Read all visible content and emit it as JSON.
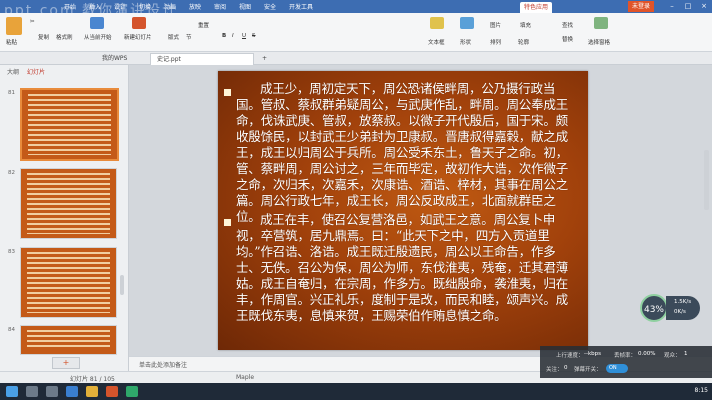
{
  "titlebar": {
    "tabs": [
      "开始",
      "插入",
      "设计",
      "切换",
      "动画",
      "放映",
      "审阅",
      "视图",
      "安全",
      "开发工具",
      "特色应用"
    ],
    "user_label": "未登录",
    "watermark": "ppt.com 教你演讲设计"
  },
  "ribbon": {
    "paste": "粘贴",
    "copy": "复制",
    "format_painter": "格式刷",
    "from_current": "从当前开始",
    "new_slide": "新建幻灯片",
    "layout": "版式",
    "section": "节",
    "reset": "重置",
    "font_buttons": [
      "B",
      "I",
      "U",
      "S"
    ],
    "textbox": "文本框",
    "shapes": "形状",
    "arrange": "排列",
    "outline": "轮廓",
    "picture": "图片",
    "fill": "填充",
    "find": "查找",
    "replace": "替换",
    "select_pane": "选择窗格"
  },
  "doc_tabs": [
    "我的WPS",
    "史记.ppt"
  ],
  "left_panel": {
    "tabs": [
      "大纲",
      "幻灯片"
    ],
    "thumb_numbers": [
      "81",
      "82",
      "83",
      "84"
    ]
  },
  "slide": {
    "paragraph1": "成王少，周初定天下，周公恐诸侯畔周，公乃摄行政当国。管叔、蔡叔群弟疑周公，与武庚作乱，畔周。周公奉成王命，伐诛武庚、管叔，放蔡叔。以微子开代殷后，国于宋。颇收殷馀民，以封武王少弟封为卫康叔。晋唐叔得嘉榖，献之成王，成王以归周公于兵所。周公受禾东土，鲁天子之命。初，管、蔡畔周，周公讨之，三年而毕定，故初作大诰，次作微子之命，次归禾，次嘉禾，次康诰、酒诰、梓材，其事在周公之篇。周公行政七年，成王长，周公反政成王，北面就群臣之位。",
    "paragraph2": "成王在丰，使召公复营洛邑，如武王之意。周公复卜申视，卒营筑，居九鼎焉。曰：“此天下之中，四方入贡道里均。”作召诰、洛诰。成王既迁殷遗民，周公以王命告，作多士、无佚。召公为保，周公为师，东伐淮夷，残奄，迁其君薄姑。成王自奄归，在宗周，作多方。既绌殷命，袭淮夷，归在丰，作周官。兴正礼乐，度制于是改，而民和睦，颂声兴。成王既伐东夷，息慎来贺，王赐荣伯作贿息慎之命。"
  },
  "notes": {
    "placeholder": "单击此处添加备注"
  },
  "status": {
    "slide_counter": "幻灯片 81 / 105",
    "theme": "Maple"
  },
  "overlay": {
    "speed_percent": "43%",
    "up_rate": "1.5K/s",
    "down_rate": "0K/s",
    "upload_label": "上行速度：",
    "upload_value": "--kbps",
    "loss_label": "丢帧率：",
    "loss_value": "0.00%",
    "viewers_label": "观众：",
    "viewers_value": "1",
    "attention_label": "关注：",
    "attention_value": "0",
    "danmu_label": "弹幕开关：",
    "toggle_label": "ON"
  },
  "taskbar": {
    "time": "8:15"
  }
}
